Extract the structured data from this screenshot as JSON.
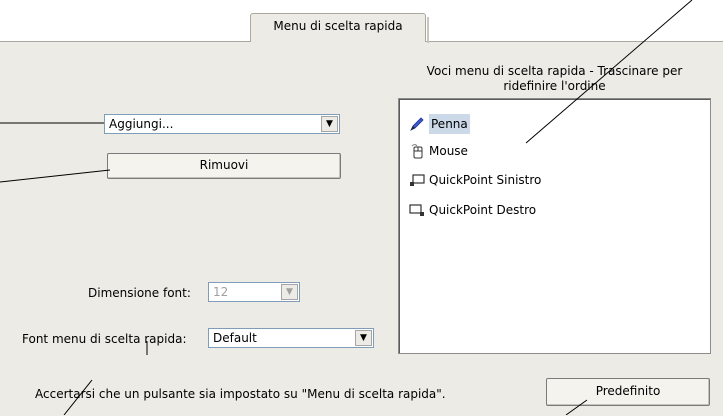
{
  "tab": {
    "label": "Menu di scelta rapida"
  },
  "list_header": {
    "line1": "Voci menu di scelta rapida - Trascinare per",
    "line2": "ridefinire l'ordine"
  },
  "add_combo": {
    "value": "Aggiungi..."
  },
  "remove_button": {
    "label": "Rimuovi"
  },
  "font_size": {
    "label": "Dimensione font:",
    "value": "12"
  },
  "font_menu": {
    "label": "Font menu di scelta rapida:",
    "value": "Default"
  },
  "menu_items": [
    {
      "label": "Penna",
      "icon": "pen-icon",
      "selected": true
    },
    {
      "label": "Mouse",
      "icon": "mouse-icon",
      "selected": false
    },
    {
      "label": "QuickPoint Sinistro",
      "icon": "quickpoint-left-icon",
      "selected": false
    },
    {
      "label": "QuickPoint Destro",
      "icon": "quickpoint-right-icon",
      "selected": false
    }
  ],
  "footer": {
    "note": "Accertarsi che un pulsante sia impostato su \"Menu di scelta rapida\".",
    "default_button": "Predefinito"
  },
  "colors": {
    "panel": "#ecebe5",
    "selection": "#ccd9e8",
    "field_border": "#7f9db9"
  }
}
